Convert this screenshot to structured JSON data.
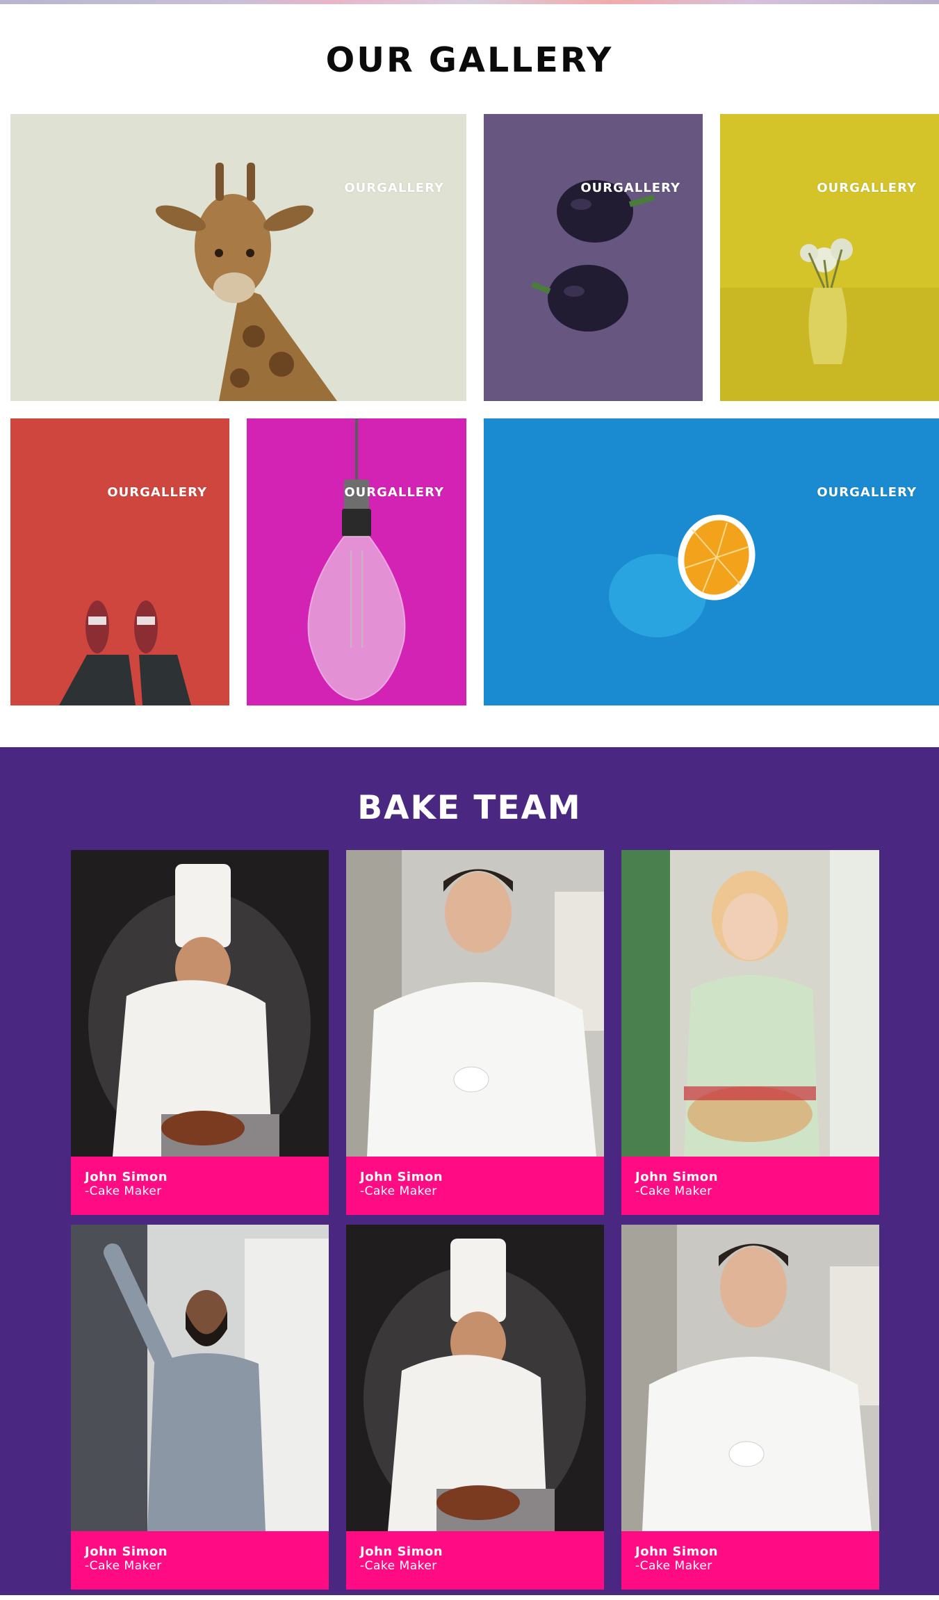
{
  "gallery": {
    "title": "OUR GALLERY",
    "tiles": [
      {
        "label": "OURGALLERY",
        "subject": "giraffe",
        "bg": "#dde1cf"
      },
      {
        "label": "OURGALLERY",
        "subject": "eggplants",
        "bg": "#665680"
      },
      {
        "label": "OURGALLERY",
        "subject": "flower-vase",
        "bg": "#d5c62a"
      },
      {
        "label": "OURGALLERY",
        "subject": "shoes-on-red",
        "bg": "#d0453f"
      },
      {
        "label": "OURGALLERY",
        "subject": "light-bulb",
        "bg": "#d623b4"
      },
      {
        "label": "OURGALLERY",
        "subject": "orange",
        "bg": "#1488cf"
      }
    ]
  },
  "team": {
    "title": "BAKE TEAM",
    "accent": "#ff0c84",
    "background": "#4a2780",
    "members": [
      {
        "name": "John Simon",
        "role": "-Cake Maker"
      },
      {
        "name": "John Simon",
        "role": "-Cake Maker"
      },
      {
        "name": "John Simon",
        "role": "-Cake Maker"
      },
      {
        "name": "John Simon",
        "role": "-Cake Maker"
      },
      {
        "name": "John Simon",
        "role": "-Cake Maker"
      },
      {
        "name": "John Simon",
        "role": "-Cake Maker"
      }
    ]
  }
}
